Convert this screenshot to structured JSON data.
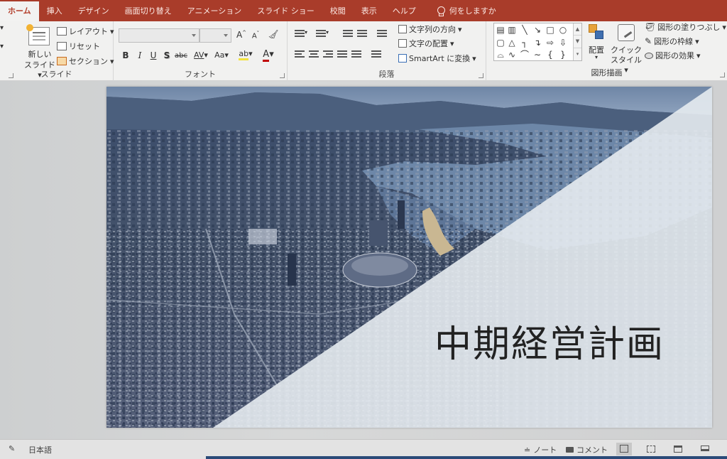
{
  "tabs": [
    {
      "label": "ホーム",
      "active": true
    },
    {
      "label": "挿入"
    },
    {
      "label": "デザイン"
    },
    {
      "label": "画面切り替え"
    },
    {
      "label": "アニメーション"
    },
    {
      "label": "スライド ショー"
    },
    {
      "label": "校閲"
    },
    {
      "label": "表示"
    },
    {
      "label": "ヘルプ"
    }
  ],
  "tell_me": "何をしますか",
  "ribbon": {
    "slides": {
      "label": "スライド",
      "new_slide": "新しい",
      "new_slide_2": "スライド",
      "layout": "レイアウト",
      "reset": "リセット",
      "section": "セクション"
    },
    "font": {
      "label": "フォント",
      "font_name": "",
      "font_size": "",
      "bold": "B",
      "italic": "I",
      "underline": "U",
      "shadow": "S",
      "strike": "abc",
      "spacing": "AV",
      "case": "Aa",
      "grow": "A",
      "shrink": "A",
      "color": "A"
    },
    "paragraph": {
      "label": "段落",
      "text_direction": "文字列の方向",
      "align_text": "文字の配置",
      "smartart": "SmartArt に変換"
    },
    "drawing": {
      "label": "図形描画",
      "arrange": "配置",
      "quick_styles": "クイック",
      "quick_styles_2": "スタイル",
      "shape_fill": "図形の塗りつぶし",
      "shape_outline": "図形の枠線",
      "shape_effects": "図形の効果"
    }
  },
  "slide": {
    "title": "中期経営計画"
  },
  "status": {
    "language": "日本語",
    "notes": "ノート",
    "comments": "コメント"
  },
  "colors": {
    "accent": "#a93c2a",
    "ribbon_bg": "#f1f1f0",
    "workspace_bg": "#d3d4d4"
  }
}
